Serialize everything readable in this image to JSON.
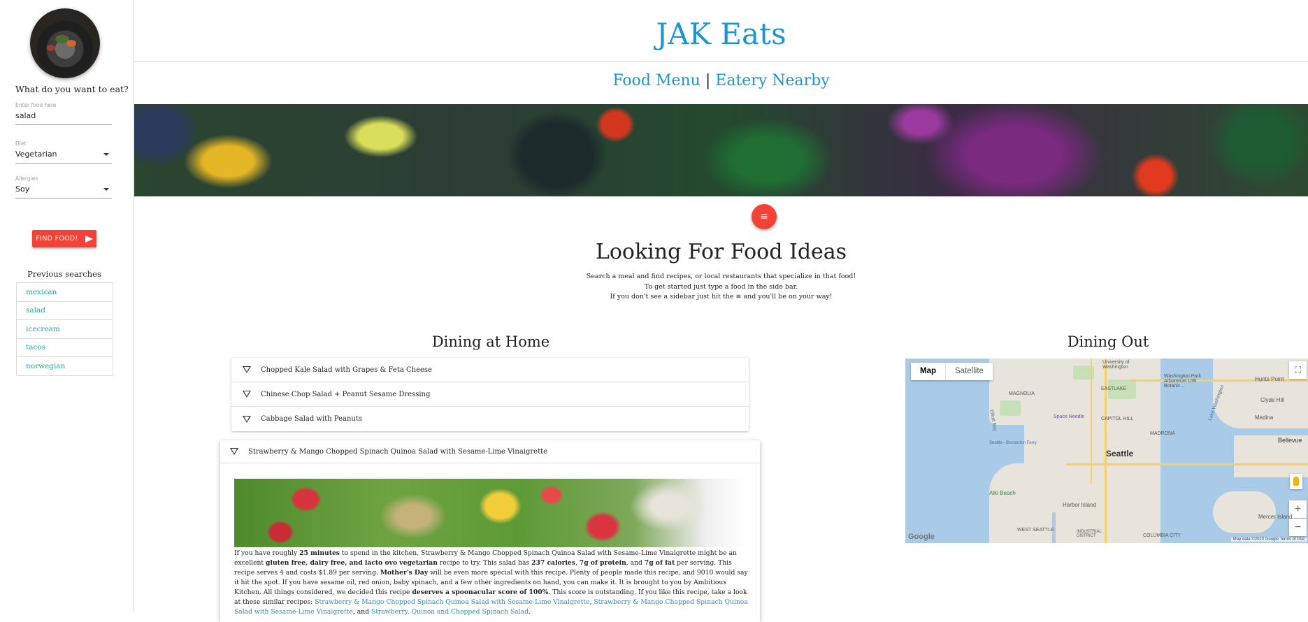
{
  "sidebar": {
    "question": "What do you want to eat?",
    "food_field": {
      "label": "Enter food here",
      "value": "salad"
    },
    "diet_field": {
      "label": "Diet",
      "value": "Vegetarian"
    },
    "allergies_field": {
      "label": "Allergies",
      "value": "Soy"
    },
    "find_button": "FIND FOOD!",
    "previous_title": "Previous searches",
    "previous": [
      "mexican",
      "salad",
      "icecream",
      "tacos",
      "norwegian"
    ]
  },
  "header": {
    "title": "JAK Eats",
    "nav": {
      "food_menu": "Food Menu",
      "separator": "|",
      "eatery": "Eatery Nearby"
    }
  },
  "main": {
    "menu_icon": "≡",
    "headline": "Looking For Food Ideas",
    "intro_line1": "Search a meal and find recipes, or local restaurants that specialize in that food!",
    "intro_line2": "To get started just type a food in the side bar.",
    "intro_line3_a": "If you don't see a sidebar just hit the",
    "intro_line3_icon": "≡",
    "intro_line3_b": "and you'll be on your way!",
    "dining_home": "Dining at Home",
    "dining_out": "Dining Out",
    "recipes": [
      "Chopped Kale Salad with Grapes & Feta Cheese",
      "Chinese Chop Salad + Peanut Sesame Dressing",
      "Cabbage Salad with Peanuts"
    ],
    "expanded_recipe": {
      "title": "Strawberry & Mango Chopped Spinach Quinoa Salad with Sesame-Lime Vinaigrette",
      "t1": "If you have roughly ",
      "b1": "25 minutes",
      "t2": " to spend in the kitchen, Strawberry & Mango Chopped Spinach Quinoa Salad with Sesame-Lime Vinaigrette might be an excellent ",
      "b2": "gluten free, dairy free, and lacto ovo vegetarian",
      "t3": " recipe to try. This salad has ",
      "b3": "237 calories",
      "t4": ", ",
      "b4": "7g of protein",
      "t5": ", and ",
      "b5": "7g of fat",
      "t6": " per serving. This recipe serves 4 and costs $1.89 per serving. ",
      "b6": "Mother's Day",
      "t7": " will be even more special with this recipe. Plenty of people made this recipe, and 9010 would say it hit the spot. If you have sesame oil, red onion, baby spinach, and a few other ingredients on hand, you can make it. It is brought to you by Ambitious Kitchen. All things considered, we decided this recipe ",
      "b7": "deserves a spoonacular score of 100%",
      "t8": ". This score is outstanding. If you like this recipe, take a look at these similar recipes: ",
      "l1": "Strawberry & Mango Chopped Spinach Quinoa Salad with Sesame-Lime Vinaigrette",
      "t9": ", ",
      "l2": "Strawberry & Mango Chopped Spinach Quinoa Salad with Sesame-Lime Vinaigrette",
      "t10": ", and ",
      "l3": "Strawberry, Quinoa and Chopped Spinach Salad",
      "t11": "."
    }
  },
  "map": {
    "type_map": "Map",
    "type_satellite": "Satellite",
    "city": "Seattle",
    "labels": {
      "uw": "University of Washington",
      "arboretum": "Washington Park Arboretum UW Botanic...",
      "space_needle": "Space Needle",
      "capitol_hill": "CAPITOL HILL",
      "magnolia": "MAGNOLIA",
      "eastlake": "EASTLAKE",
      "madrona": "MADRONA",
      "medina": "Medina",
      "clyde_hill": "Clyde Hill",
      "hunts_point": "Hunts Point",
      "bellevue": "Bellevue",
      "mercer": "Mercer Island",
      "alki": "Alki Beach",
      "harbor_island": "Harbor Island",
      "west_seattle": "WEST SEATTLE",
      "elliott_bay": "Elliott Bay",
      "lake_washington": "Lake Washington",
      "ferry": "Seattle - Bremerton Ferry",
      "industrial": "INDUSTRIAL DISTRICT",
      "columbia": "COLUMBIA CITY"
    },
    "zoom_in": "+",
    "zoom_out": "−",
    "logo": "Google",
    "footer": "Map data ©2020 Google   Terms of Use"
  }
}
